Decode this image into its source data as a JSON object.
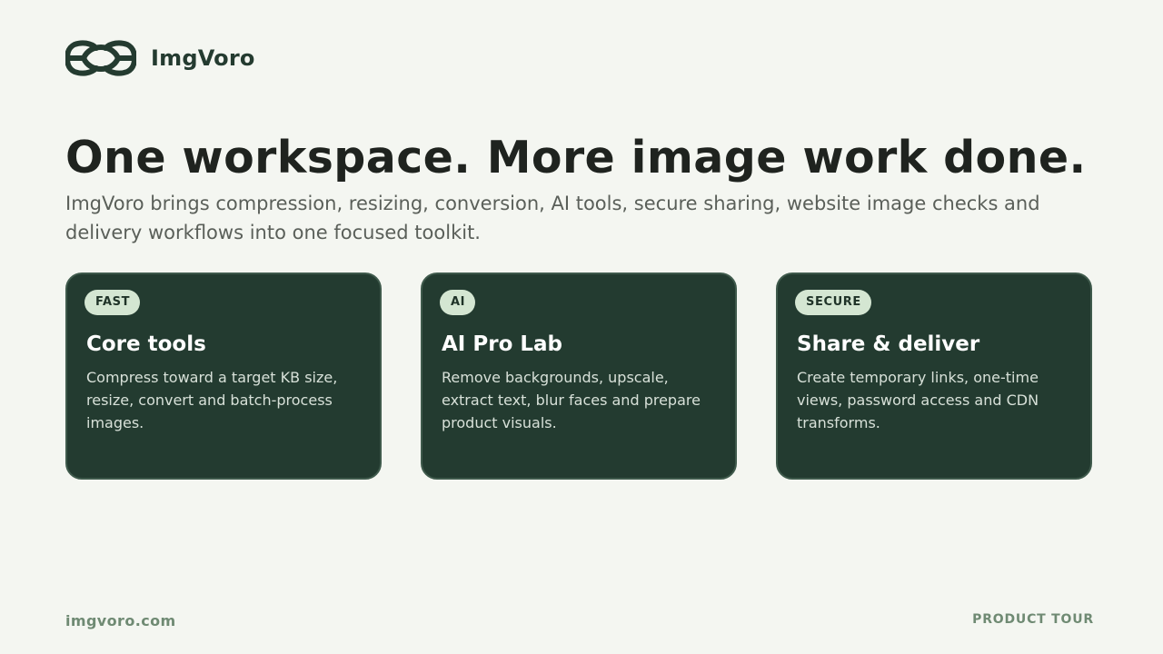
{
  "brand": {
    "name": "ImgVoro",
    "logo_icon": "interlocking-rings-logo",
    "color": "#243b30"
  },
  "hero": {
    "title": "One workspace. More image work done.",
    "subtitle": "ImgVoro brings compression, resizing, conversion, AI tools, secure sharing, website image checks and delivery workflows into one focused toolkit."
  },
  "cards": [
    {
      "badge": "FAST",
      "title": "Core tools",
      "text": "Compress toward a target KB size, resize, convert and batch-process images."
    },
    {
      "badge": "AI",
      "title": "AI Pro Lab",
      "text": "Remove backgrounds, upscale, extract text, blur faces and prepare product visuals."
    },
    {
      "badge": "SECURE",
      "title": "Share & deliver",
      "text": "Create temporary links, one-time views, password access and CDN transforms."
    }
  ],
  "footer": {
    "url": "imgvoro.com",
    "tag": "PRODUCT TOUR"
  },
  "colors": {
    "background": "#f4f6f1",
    "card_background": "#233b30",
    "badge_background": "#d4e6d2",
    "footer_text": "#6f8a73"
  }
}
